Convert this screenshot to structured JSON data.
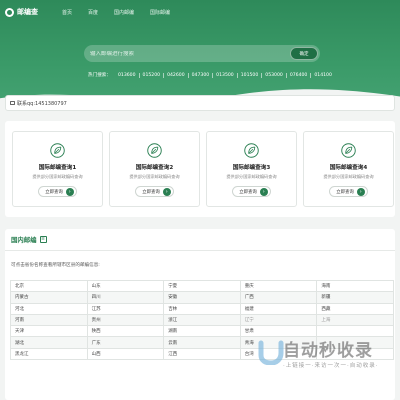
{
  "nav": {
    "logo_text": "邮编查",
    "links": [
      "首页",
      "百度",
      "国内邮编",
      "国际邮编"
    ]
  },
  "search": {
    "placeholder": "输入邮编进行搜索",
    "button_label": "确定"
  },
  "hot": {
    "label": "热门搜索：",
    "codes": [
      "013600",
      "015200",
      "042600",
      "047300",
      "013500",
      "101500",
      "053000",
      "076400",
      "014100"
    ]
  },
  "contact": {
    "text": "联系qq:1451380797"
  },
  "cards": [
    {
      "title": "国际邮编查询1",
      "desc": "提供部分国家邮政编码查询",
      "button": "立即查询"
    },
    {
      "title": "国际邮编查询2",
      "desc": "提供部分国家邮政编码查询",
      "button": "立即查询"
    },
    {
      "title": "国际邮编查询3",
      "desc": "提供部分国家邮政编码查询",
      "button": "立即查询"
    },
    {
      "title": "国际邮编查询4",
      "desc": "提供部分国家邮政编码查询",
      "button": "立即查询"
    }
  ],
  "section": {
    "title": "国内邮编",
    "subtitle": "可点击省份名称查看所辖市区县的邮编信息:",
    "rows": [
      [
        "北京",
        "山东",
        "宁夏",
        "重庆",
        "海南"
      ],
      [
        "内蒙古",
        "四川",
        "安徽",
        "广西",
        "新疆"
      ],
      [
        "河北",
        "江苏",
        "吉林",
        "福建",
        "西藏"
      ],
      [
        "河南",
        "贵州",
        "浙江",
        "辽宁",
        "上海"
      ],
      [
        "天津",
        "陕西",
        "湖南",
        "甘肃",
        ""
      ],
      [
        "湖北",
        "广东",
        "云南",
        "青海",
        ""
      ],
      [
        "黑龙江",
        "山西",
        "江西",
        "台湾",
        ""
      ]
    ]
  },
  "watermark": {
    "text": "自动秒收录",
    "subtext": "·上链接一·来访一次一·自动收录·"
  },
  "colors": {
    "brand": "#2e8a5a",
    "accent": "#2a7f52"
  }
}
